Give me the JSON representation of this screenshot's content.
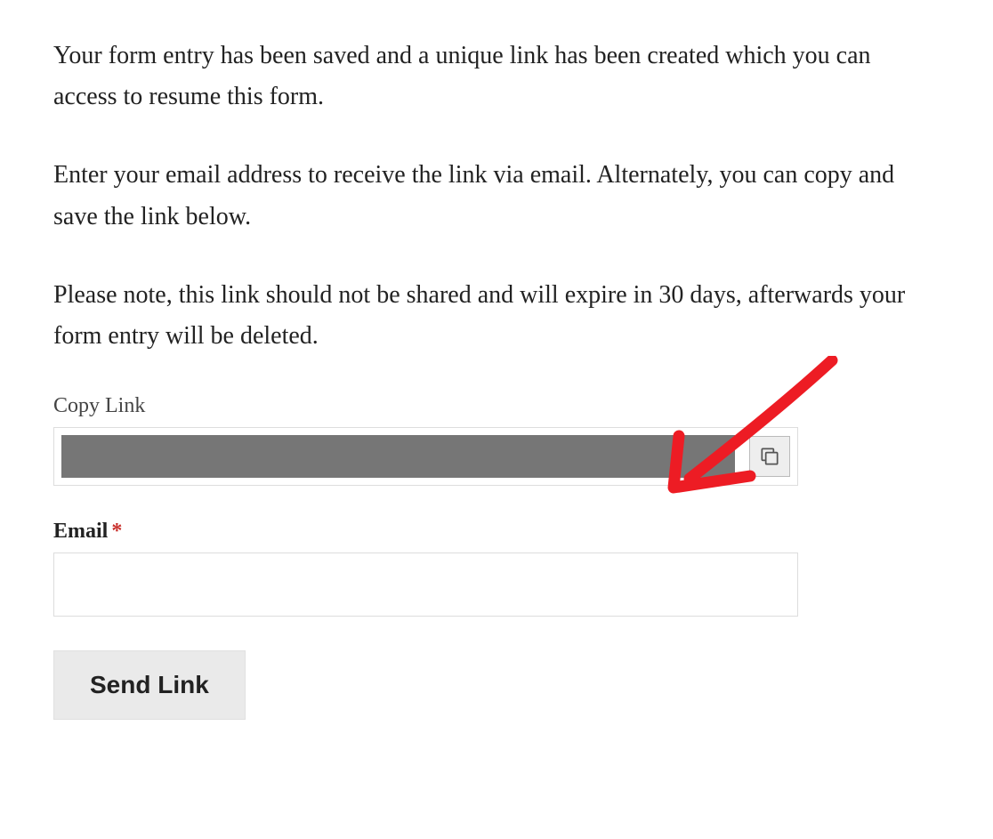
{
  "paragraphs": {
    "p1": "Your form entry has been saved and a unique link has been created which you can access to resume this form.",
    "p2": "Enter your email address to receive the link via email. Alternately, you can copy and save the link below.",
    "p3": "Please note, this link should not be shared and will expire in 30 days, afterwards your form entry will be deleted."
  },
  "fields": {
    "copyLink": {
      "label": "Copy Link",
      "value": ""
    },
    "email": {
      "label": "Email",
      "required": "*",
      "value": ""
    }
  },
  "buttons": {
    "send": "Send Link"
  },
  "annotation": {
    "arrow": "hand-drawn-arrow"
  }
}
